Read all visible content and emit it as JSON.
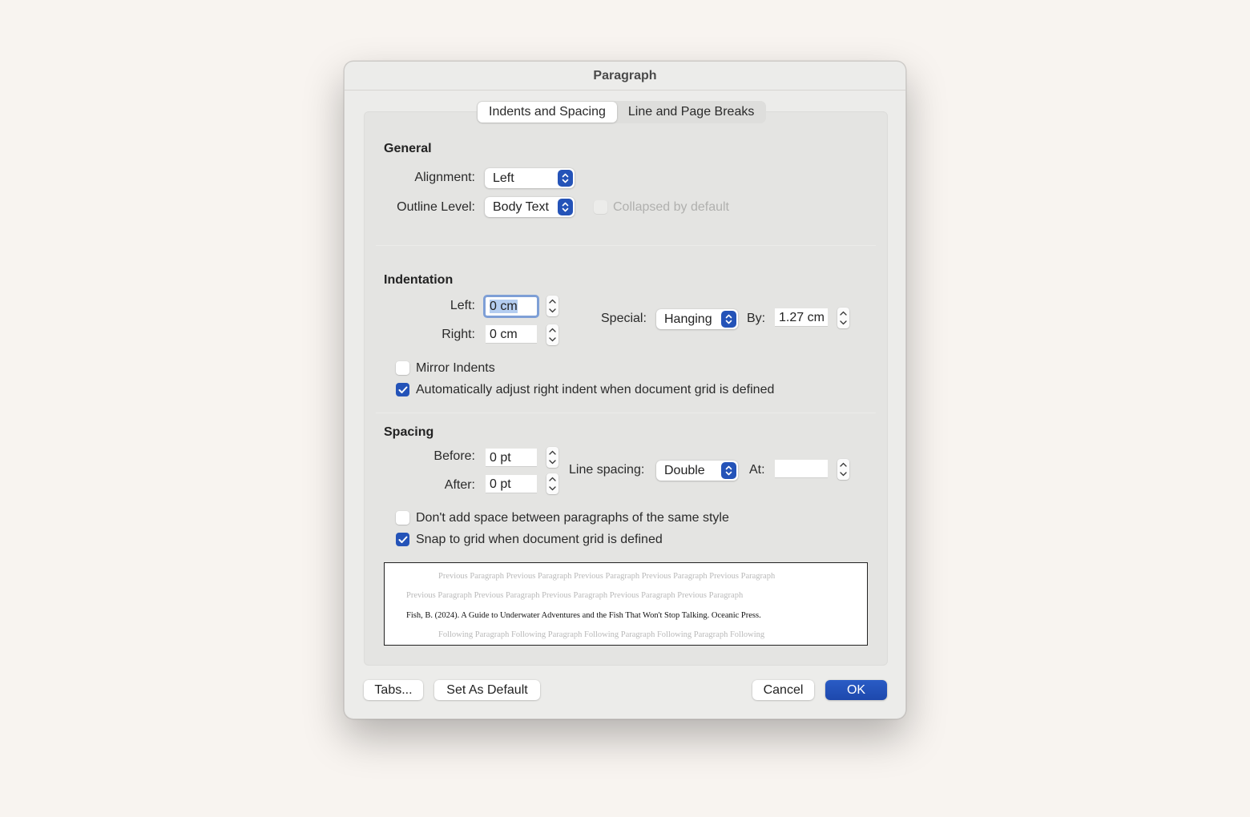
{
  "dialog": {
    "title": "Paragraph",
    "tabs": [
      {
        "label": "Indents and Spacing",
        "active": true
      },
      {
        "label": "Line and Page Breaks",
        "active": false
      }
    ]
  },
  "general": {
    "title": "General",
    "alignment_label": "Alignment:",
    "alignment_value": "Left",
    "outline_label": "Outline Level:",
    "outline_value": "Body Text",
    "collapsed_label": "Collapsed by default",
    "collapsed_checked": false,
    "collapsed_enabled": false
  },
  "indentation": {
    "title": "Indentation",
    "left_label": "Left:",
    "left_value": "0 cm",
    "right_label": "Right:",
    "right_value": "0 cm",
    "special_label": "Special:",
    "special_value": "Hanging",
    "by_label": "By:",
    "by_value": "1.27 cm",
    "mirror_label": "Mirror Indents",
    "mirror_checked": false,
    "auto_adjust_label": "Automatically adjust right indent when document grid is defined",
    "auto_adjust_checked": true
  },
  "spacing": {
    "title": "Spacing",
    "before_label": "Before:",
    "before_value": "0 pt",
    "after_label": "After:",
    "after_value": "0 pt",
    "line_spacing_label": "Line spacing:",
    "line_spacing_value": "Double",
    "at_label": "At:",
    "at_value": "",
    "dont_add_label": "Don't add space between paragraphs of the same style",
    "dont_add_checked": false,
    "snap_label": "Snap to grid when document grid is defined",
    "snap_checked": true
  },
  "preview": {
    "previous_line1": "Previous Paragraph Previous Paragraph Previous Paragraph Previous Paragraph Previous Paragraph",
    "previous_line2": "Previous Paragraph Previous Paragraph Previous Paragraph Previous Paragraph Previous Paragraph",
    "current": "Fish, B. (2024). A Guide to Underwater Adventures and the Fish That Won't Stop Talking. Oceanic Press.",
    "following": "Following Paragraph Following Paragraph Following Paragraph Following Paragraph Following"
  },
  "buttons": {
    "tabs": "Tabs...",
    "set_default": "Set As Default",
    "cancel": "Cancel",
    "ok": "OK"
  },
  "colors": {
    "accent": "#2453b8",
    "background": "#f8f4f0",
    "focus_ring": "#7e9fd6"
  }
}
